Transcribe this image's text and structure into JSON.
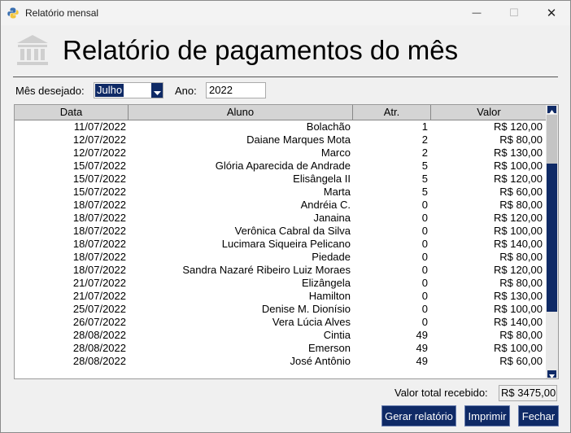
{
  "window": {
    "title": "Relatório mensal",
    "minimize": "—",
    "maximize": "☐",
    "close": "✕"
  },
  "heading": "Relatório de pagamentos do mês",
  "filters": {
    "month_label": "Mês desejado:",
    "month_value": "Julho",
    "year_label": "Ano:",
    "year_value": "2022"
  },
  "table": {
    "columns": [
      "Data",
      "Aluno",
      "Atr.",
      "Valor"
    ],
    "rows": [
      [
        "11/07/2022",
        "Bolachão",
        "1",
        "R$ 120,00"
      ],
      [
        "12/07/2022",
        "Daiane Marques Mota",
        "2",
        "R$ 80,00"
      ],
      [
        "12/07/2022",
        "Marco",
        "2",
        "R$ 130,00"
      ],
      [
        "15/07/2022",
        "Glória Aparecida de Andrade",
        "5",
        "R$ 100,00"
      ],
      [
        "15/07/2022",
        "Elisângela II",
        "5",
        "R$ 120,00"
      ],
      [
        "15/07/2022",
        "Marta",
        "5",
        "R$ 60,00"
      ],
      [
        "18/07/2022",
        "Andréia C.",
        "0",
        "R$ 80,00"
      ],
      [
        "18/07/2022",
        "Janaina",
        "0",
        "R$ 120,00"
      ],
      [
        "18/07/2022",
        "Verônica Cabral da Silva",
        "0",
        "R$ 100,00"
      ],
      [
        "18/07/2022",
        "Lucimara Siqueira Pelicano",
        "0",
        "R$ 140,00"
      ],
      [
        "18/07/2022",
        "Piedade",
        "0",
        "R$ 80,00"
      ],
      [
        "18/07/2022",
        "Sandra Nazaré Ribeiro Luiz Moraes",
        "0",
        "R$ 120,00"
      ],
      [
        "21/07/2022",
        "Elizângela",
        "0",
        "R$ 80,00"
      ],
      [
        "21/07/2022",
        "Hamilton",
        "0",
        "R$ 130,00"
      ],
      [
        "25/07/2022",
        "Denise M. Dionísio",
        "0",
        "R$ 100,00"
      ],
      [
        "26/07/2022",
        "Vera Lúcia Alves",
        "0",
        "R$ 140,00"
      ],
      [
        "28/08/2022",
        "Cintia",
        "49",
        "R$ 80,00"
      ],
      [
        "28/08/2022",
        "Emerson",
        "49",
        "R$ 100,00"
      ],
      [
        "28/08/2022",
        "José Antônio",
        "49",
        "R$ 60,00"
      ]
    ]
  },
  "footer": {
    "total_label": "Valor total recebido:",
    "total_value": "R$ 3475,00",
    "buttons": {
      "generate": "Gerar relatório",
      "print": "Imprimir",
      "close": "Fechar"
    }
  },
  "icons": {
    "app": "python-icon",
    "header": "bank-icon"
  },
  "colors": {
    "accent": "#0f2a66",
    "background": "#f0f0f0"
  }
}
